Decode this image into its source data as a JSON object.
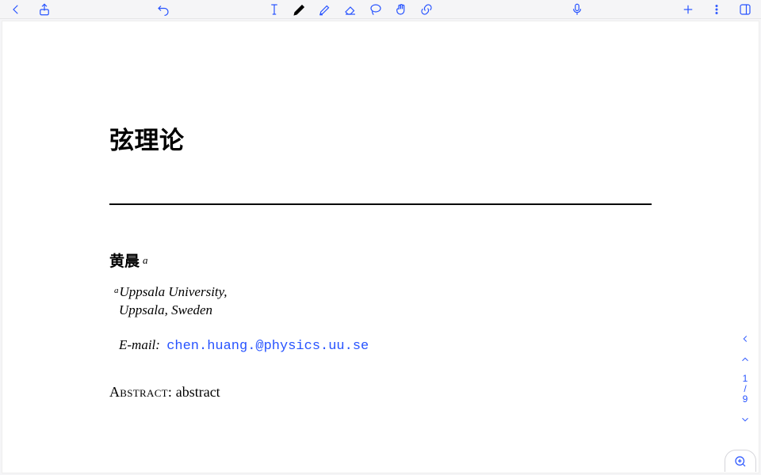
{
  "toolbar": {
    "icons": {
      "back": "chevron-left",
      "share": "share",
      "undo": "undo",
      "text": "text-cursor",
      "pen": "pen",
      "highlighter": "highlighter",
      "eraser": "eraser",
      "lasso": "lasso",
      "hand": "hand",
      "link": "link",
      "mic": "microphone",
      "add": "plus",
      "more": "more-vertical",
      "panel": "sidebar-panel"
    }
  },
  "document": {
    "title": "弦理论",
    "author": "黄晨",
    "author_sup": "a",
    "affil_sup": "a",
    "affil_line1": "Uppsala University,",
    "affil_line2": "Uppsala, Sweden",
    "email_label": "E-mail:",
    "email": "chen.huang.@physics.uu.se",
    "abstract_label": "Abstract:",
    "abstract_text": "abstract"
  },
  "pager": {
    "current": "1",
    "sep": "/",
    "total": "9"
  }
}
